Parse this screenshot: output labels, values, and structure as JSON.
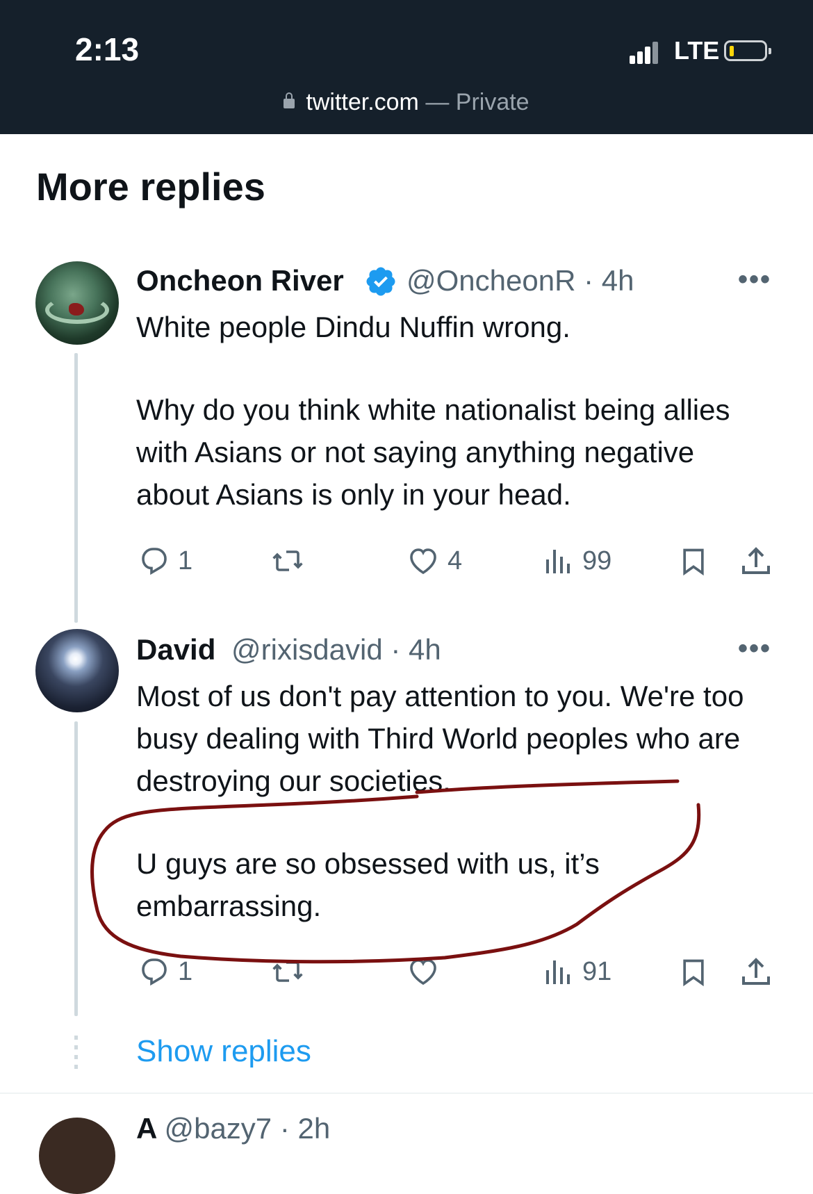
{
  "status_bar": {
    "time": "2:13",
    "network": "LTE",
    "url_host": "twitter.com",
    "url_suffix": " — Private"
  },
  "section": {
    "title": "More replies"
  },
  "tweets": [
    {
      "name": "Oncheon River",
      "verified": true,
      "handle": "@OncheonR · 4h",
      "text": [
        "White people Dindu Nuffin wrong.",
        "Why do you think white nationalist being allies with Asians or not saying anything negative about Asians is only in your head."
      ],
      "replies": "1",
      "retweets": "",
      "likes": "4",
      "views": "99"
    },
    {
      "name": "David",
      "verified": false,
      "handle": "@rixisdavid · 4h",
      "text": [
        "Most of us don't pay attention to you. We're too busy dealing with Third World peoples who are destroying our societies.",
        "U guys are so obsessed with us, it’s embarrassing."
      ],
      "replies": "1",
      "retweets": "",
      "likes": "",
      "views": "91"
    }
  ],
  "show_replies_label": "Show replies",
  "next_tweet_peek": {
    "name": "A",
    "handle": "@bazy7 · 2h"
  },
  "colors": {
    "status_bg": "#15202b",
    "link_blue": "#1d9bf0",
    "muted": "#536471",
    "annotation": "#7a1010"
  },
  "icons": [
    "lock-icon",
    "signal-icon",
    "battery-icon",
    "verified-badge-icon",
    "more-options-icon",
    "reply-icon",
    "retweet-icon",
    "like-icon",
    "views-icon",
    "bookmark-icon",
    "share-icon"
  ]
}
